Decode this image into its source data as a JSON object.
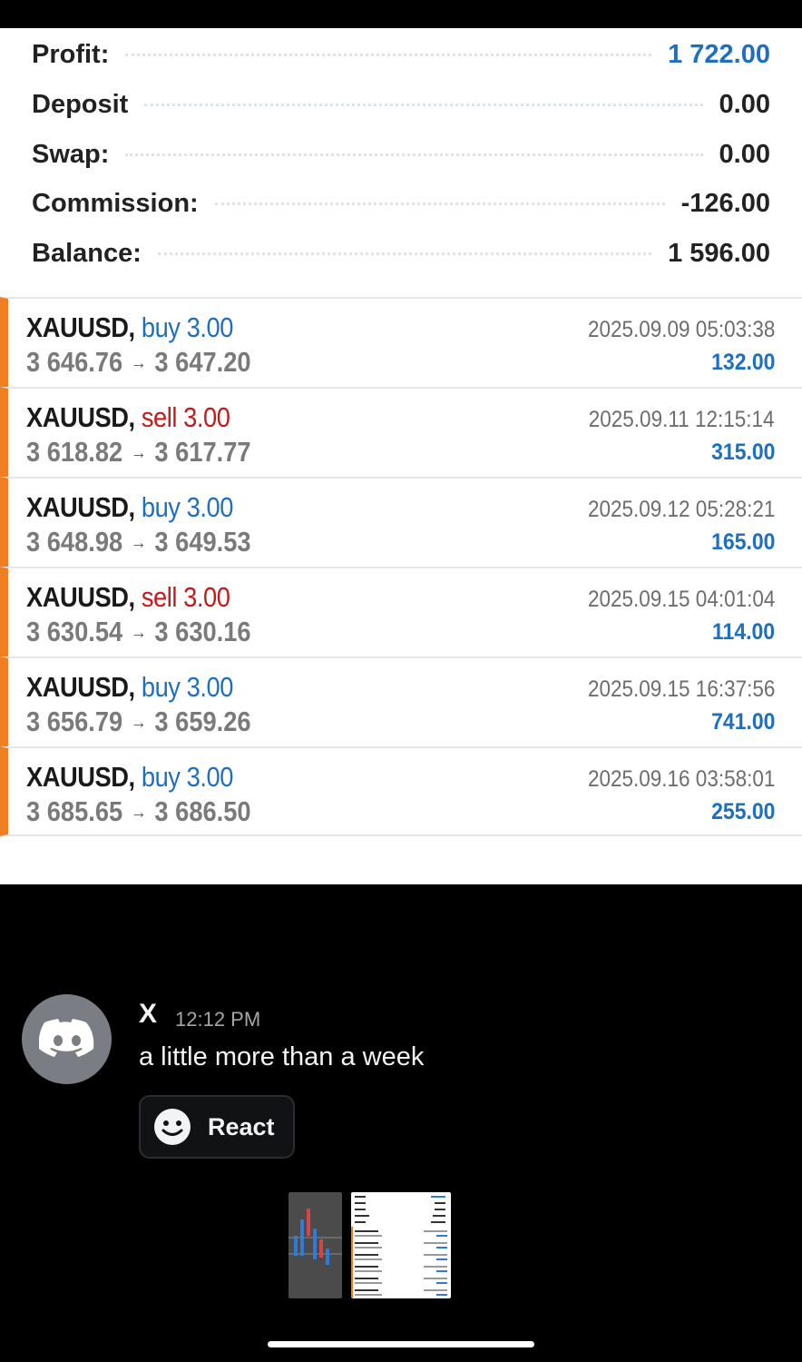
{
  "summary": [
    {
      "label": "Profit:",
      "value": "1 722.00",
      "accent": true
    },
    {
      "label": "Deposit",
      "value": "0.00",
      "accent": false
    },
    {
      "label": "Swap:",
      "value": "0.00",
      "accent": false
    },
    {
      "label": "Commission:",
      "value": "-126.00",
      "accent": false
    },
    {
      "label": "Balance:",
      "value": "1 596.00",
      "accent": false
    }
  ],
  "trades": [
    {
      "symbol": "XAUUSD,",
      "side": "buy 3.00",
      "direction": "buy",
      "open": "3 646.76",
      "close": "3 647.20",
      "time": "2025.09.09 05:03:38",
      "profit": "132.00"
    },
    {
      "symbol": "XAUUSD,",
      "side": "sell 3.00",
      "direction": "sell",
      "open": "3 618.82",
      "close": "3 617.77",
      "time": "2025.09.11 12:15:14",
      "profit": "315.00"
    },
    {
      "symbol": "XAUUSD,",
      "side": "buy 3.00",
      "direction": "buy",
      "open": "3 648.98",
      "close": "3 649.53",
      "time": "2025.09.12 05:28:21",
      "profit": "165.00"
    },
    {
      "symbol": "XAUUSD,",
      "side": "sell 3.00",
      "direction": "sell",
      "open": "3 630.54",
      "close": "3 630.16",
      "time": "2025.09.15 04:01:04",
      "profit": "114.00"
    },
    {
      "symbol": "XAUUSD,",
      "side": "buy 3.00",
      "direction": "buy",
      "open": "3 656.79",
      "close": "3 659.26",
      "time": "2025.09.15 16:37:56",
      "profit": "741.00"
    },
    {
      "symbol": "XAUUSD,",
      "side": "buy 3.00",
      "direction": "buy",
      "open": "3 685.65",
      "close": "3 686.50",
      "time": "2025.09.16 03:58:01",
      "profit": "255.00"
    }
  ],
  "message": {
    "author": "X",
    "time": "12:12 PM",
    "text": "a little more than a week",
    "react_label": "React",
    "avatar_icon": "discord-logo-icon"
  },
  "colors": {
    "buy": "#1f6fbf",
    "sell": "#c01c1c",
    "accent_stripe": "#f07f24",
    "profit": "#1f6fbf"
  }
}
